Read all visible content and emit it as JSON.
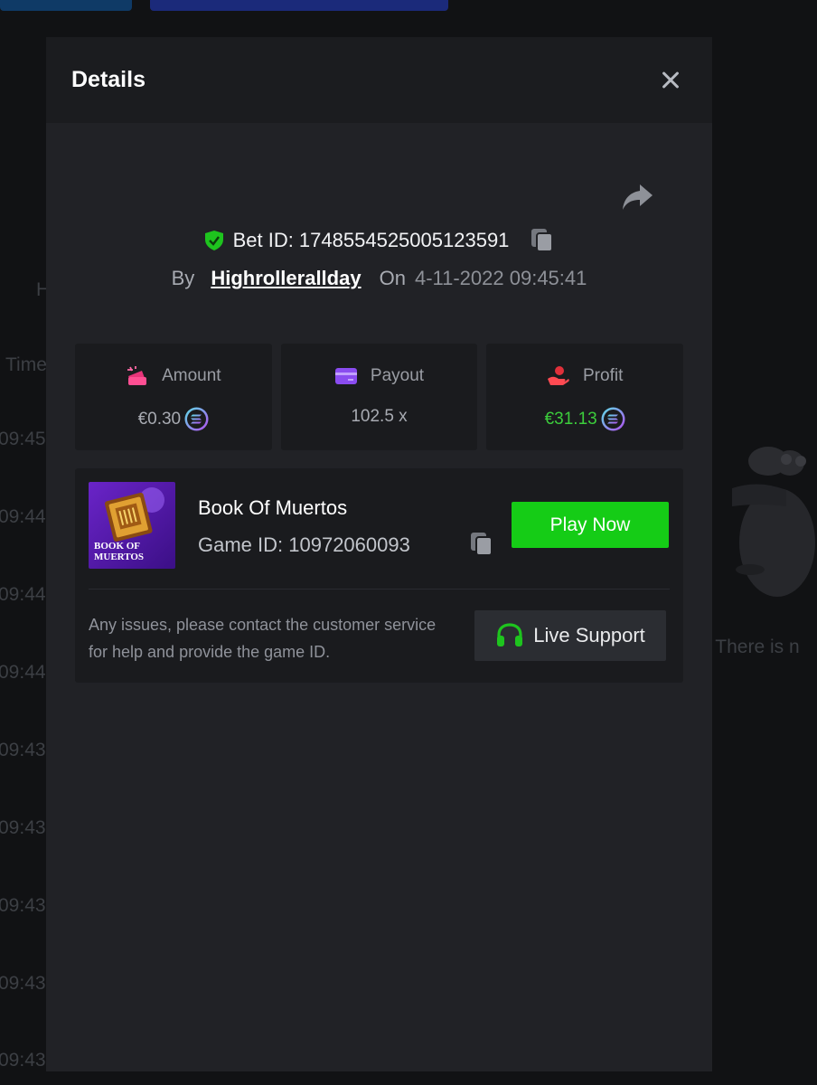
{
  "background": {
    "header_letter": "H",
    "time_header": "Time",
    "time_rows": [
      "09:45:",
      "09:44:",
      "09:44:",
      "09:44:",
      "09:43:",
      "09:43:",
      "09:43:",
      "09:43:",
      "09:43:"
    ],
    "empty_text": "! There is n"
  },
  "modal": {
    "title": "Details",
    "bet": {
      "label": "Bet ID: 1748554525005123591",
      "by": "By",
      "user": "Highrollerallday",
      "on": "On",
      "date": "4-11-2022 09:45:41"
    },
    "stats": {
      "amount": {
        "label": "Amount",
        "value": "€0.30"
      },
      "payout": {
        "label": "Payout",
        "value": "102.5 x"
      },
      "profit": {
        "label": "Profit",
        "value": "€31.13"
      }
    },
    "game": {
      "title": "Book Of Muertos",
      "id_label": "Game ID: 10972060093",
      "thumb_text": "BOOK OF MUERTOS",
      "play_label": "Play Now",
      "support_text": "Any issues, please contact the customer service for help and provide the game ID.",
      "support_label": "Live Support"
    },
    "colors": {
      "accent_green": "#15cc16",
      "profit_green": "#3ccc3c",
      "shield_green": "#1ec41e",
      "amount_pink": "#e8357a",
      "payout_purple": "#8a4cf0",
      "profit_red": "#e0303a"
    },
    "icons": [
      "close-icon",
      "share-icon",
      "shield-check-icon",
      "copy-icon",
      "wallet-icon",
      "card-icon",
      "hand-coin-icon",
      "solana-coin-icon",
      "headset-icon"
    ]
  }
}
